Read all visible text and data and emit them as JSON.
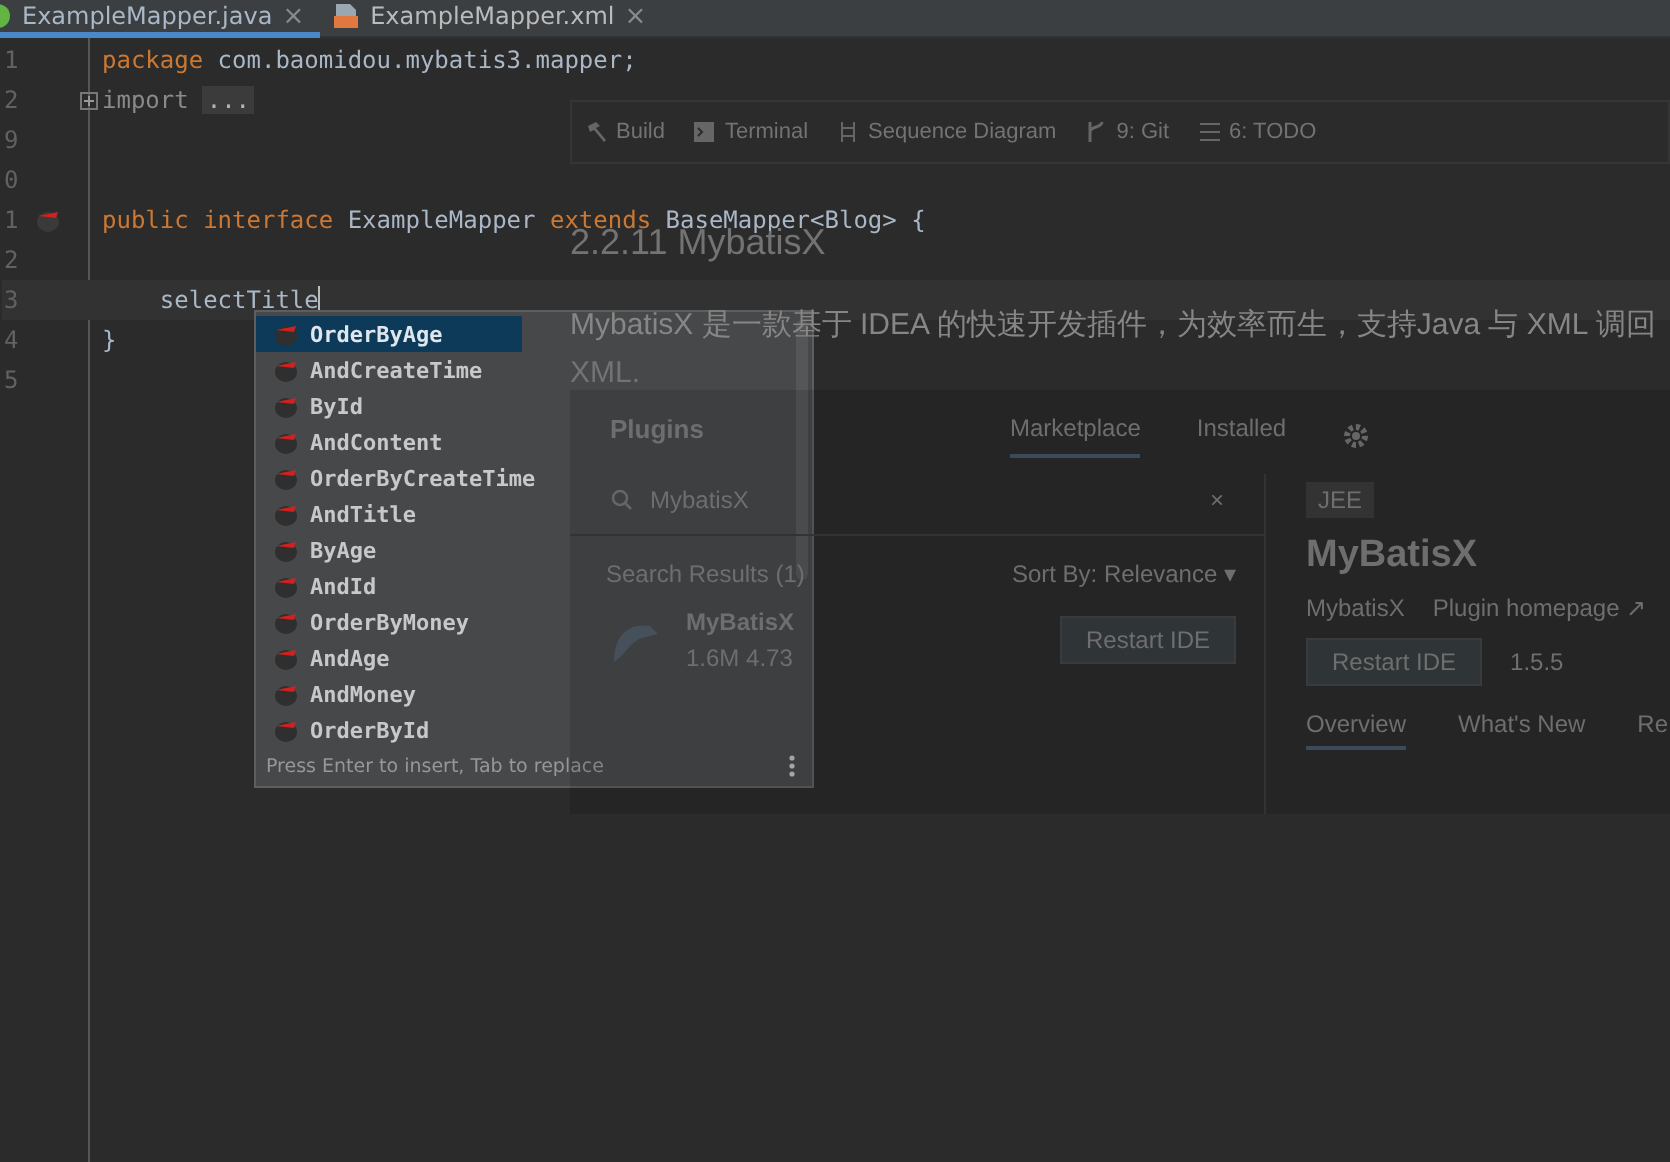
{
  "tabs": [
    {
      "label": "ExampleMapper.java",
      "kind": "java",
      "selected": true,
      "close": "×"
    },
    {
      "label": "ExampleMapper.xml",
      "kind": "xml",
      "selected": false,
      "close": "×"
    }
  ],
  "editor": {
    "lines": [
      {
        "number": "1",
        "tokens": [
          {
            "kind": "keyword",
            "text": "package"
          },
          {
            "kind": "plain",
            "text": " com.baomidou.mybatis3.mapper;"
          }
        ]
      },
      {
        "number": "2",
        "fold_marker": true,
        "tokens": [
          {
            "kind": "dim",
            "text": "import"
          },
          {
            "kind": "fold",
            "text": "..."
          }
        ]
      },
      {
        "number": "9"
      },
      {
        "number": "0"
      },
      {
        "number": "1",
        "gutter_icon": true,
        "tokens": [
          {
            "kind": "keyword",
            "text": "public interface"
          },
          {
            "kind": "plain",
            "text": " ExampleMapper "
          },
          {
            "kind": "keyword",
            "text": "extends"
          },
          {
            "kind": "plain",
            "text": " BaseMapper<Blog> {"
          }
        ]
      },
      {
        "number": "2"
      },
      {
        "number": "3",
        "current": true,
        "tokens": [
          {
            "kind": "plain",
            "text": "    selectTitle"
          }
        ]
      },
      {
        "number": "4",
        "tokens": [
          {
            "kind": "plain",
            "text": "}"
          }
        ]
      },
      {
        "number": "5"
      }
    ]
  },
  "completion": {
    "items": [
      {
        "label": "OrderByAge",
        "selected": true
      },
      {
        "label": "AndCreateTime",
        "selected": false
      },
      {
        "label": "ById",
        "selected": false
      },
      {
        "label": "AndContent",
        "selected": false
      },
      {
        "label": "OrderByCreateTime",
        "selected": false
      },
      {
        "label": "AndTitle",
        "selected": false
      },
      {
        "label": "ByAge",
        "selected": false
      },
      {
        "label": "AndId",
        "selected": false
      },
      {
        "label": "OrderByMoney",
        "selected": false
      },
      {
        "label": "AndAge",
        "selected": false
      },
      {
        "label": "AndMoney",
        "selected": false
      },
      {
        "label": "OrderById",
        "selected": false
      }
    ],
    "hint": "Press Enter to insert, Tab to replace"
  },
  "background_overlay": {
    "tool_windows": [
      {
        "label": "Build",
        "kind": "hammer"
      },
      {
        "label": "Terminal",
        "kind": "terminal"
      },
      {
        "label": "Sequence Diagram",
        "kind": "diagram"
      },
      {
        "label": "9: Git",
        "kind": "git"
      },
      {
        "label": "6: TODO",
        "kind": "list"
      }
    ],
    "heading": "2.2.11 MybatisX",
    "paragraph": "MybatisX 是一款基于 IDEA 的快速开发插件，为效率而生，支持Java 与 XML 调回",
    "paragraph_continued": "XML.",
    "plugins_dialog": {
      "title": "Plugins",
      "tabs": [
        {
          "label": "Marketplace",
          "selected": true
        },
        {
          "label": "Installed",
          "selected": false
        }
      ],
      "search": "MybatisX",
      "clear": "×",
      "results_label": "Search Results (1)",
      "sort": "Sort By: Relevance ▾",
      "result": {
        "name": "MyBatisX",
        "downloads": "1.6M",
        "rating": "4.73",
        "button": "Restart IDE"
      },
      "detail": {
        "tag": "JEE",
        "name": "MyBatisX",
        "vendor": "MybatisX",
        "homepage": "Plugin homepage ↗",
        "button": "Restart IDE",
        "version": "1.5.5",
        "tabs": [
          {
            "label": "Overview",
            "selected": true
          },
          {
            "label": "What's New",
            "selected": false
          },
          {
            "label": "Re",
            "selected": false
          }
        ]
      }
    }
  }
}
